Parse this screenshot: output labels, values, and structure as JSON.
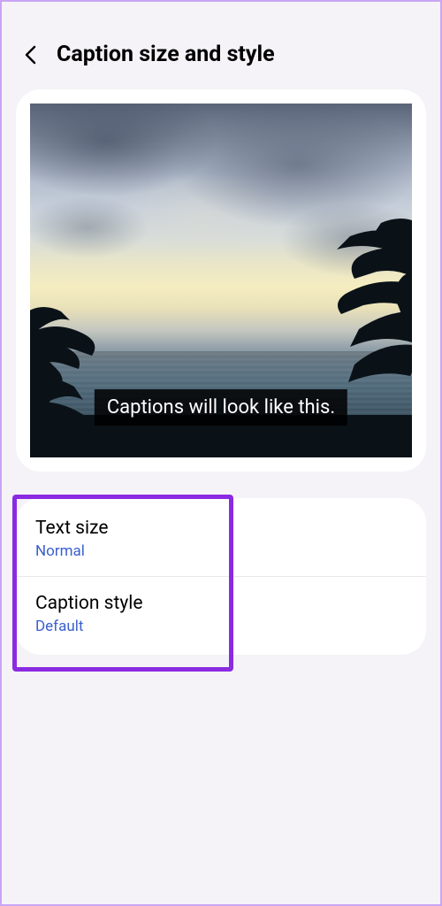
{
  "header": {
    "title": "Caption size and style"
  },
  "preview": {
    "caption_text": "Captions will look like this."
  },
  "settings": {
    "text_size": {
      "label": "Text size",
      "value": "Normal"
    },
    "caption_style": {
      "label": "Caption style",
      "value": "Default"
    }
  }
}
